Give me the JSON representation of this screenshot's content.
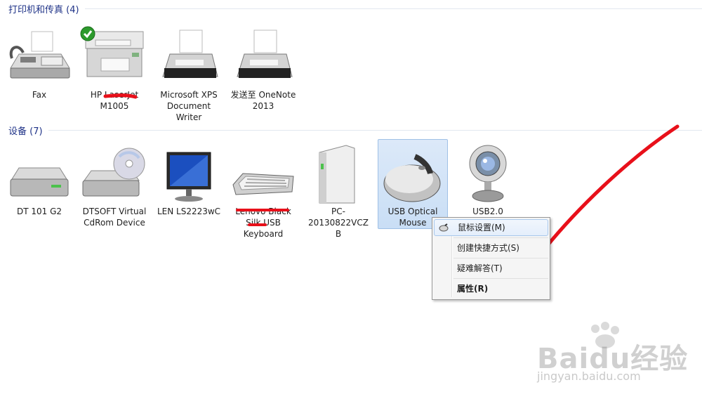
{
  "groups": {
    "printers": {
      "title": "打印机和传真 (4)"
    },
    "devices": {
      "title": "设备 (7)"
    }
  },
  "printers": [
    {
      "name": "Fax",
      "icon": "fax-icon",
      "default": false
    },
    {
      "name": "HP LaserJet M1005",
      "icon": "laser-printer-icon",
      "default": true
    },
    {
      "name": "Microsoft XPS Document Writer",
      "icon": "printer-icon",
      "default": false
    },
    {
      "name": "发送至 OneNote 2013",
      "icon": "printer-icon",
      "default": false
    }
  ],
  "devices": [
    {
      "name": "DT 101 G2",
      "icon": "usb-drive-icon"
    },
    {
      "name": "DTSOFT Virtual CdRom Device",
      "icon": "cdrom-drive-icon"
    },
    {
      "name": "LEN LS2223wC",
      "icon": "monitor-icon"
    },
    {
      "name": "Lenovo Black Silk USB Keyboard",
      "icon": "keyboard-icon"
    },
    {
      "name": "PC-20130822VCZB",
      "icon": "computer-tower-icon"
    },
    {
      "name": "USB Optical Mouse",
      "icon": "mouse-icon",
      "selected": true
    },
    {
      "name": "USB2.0 Camera",
      "icon": "webcam-icon"
    }
  ],
  "context_menu": {
    "items": [
      {
        "label": "鼠标设置(M)",
        "icon": "mouse-settings-icon",
        "highlighted": true
      },
      {
        "label": "创建快捷方式(S)"
      },
      {
        "label": "疑难解答(T)"
      },
      {
        "label": "属性(R)",
        "bold": true
      }
    ]
  },
  "watermark": {
    "logo": "Baidu经验",
    "url": "jingyan.baidu.com"
  },
  "colors": {
    "group_title": "#1e3287",
    "selection": "#c9def5",
    "annotation": "#e8101a"
  }
}
